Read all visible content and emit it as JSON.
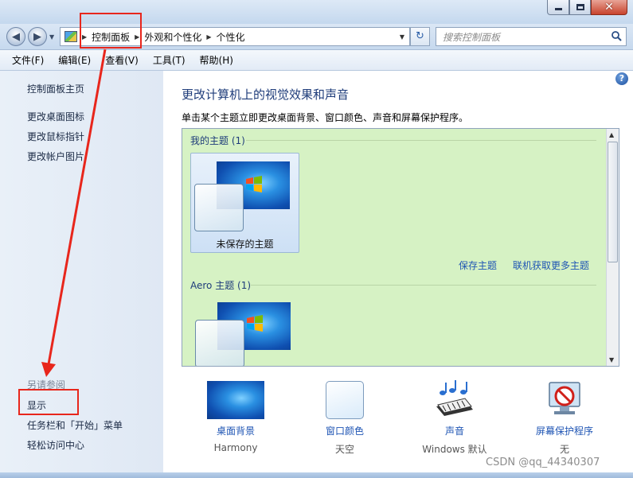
{
  "window": {
    "minimize_icon": "minimize-icon",
    "maximize_icon": "maximize-icon",
    "close_icon": "close-icon",
    "close_glyph": "✕"
  },
  "navigation": {
    "back_icon": "back-arrow-icon",
    "forward_icon": "forward-arrow-icon",
    "breadcrumbs": [
      "控制面板",
      "外观和个性化",
      "个性化"
    ],
    "search_placeholder": "搜索控制面板",
    "refresh_icon": "refresh-icon"
  },
  "menu": [
    "文件(F)",
    "编辑(E)",
    "查看(V)",
    "工具(T)",
    "帮助(H)"
  ],
  "sidebar": {
    "home_link": "控制面板主页",
    "links": [
      "更改桌面图标",
      "更改鼠标指针",
      "更改帐户图片"
    ],
    "see_also_title": "另请参阅",
    "see_also_links": [
      "显示",
      "任务栏和「开始」菜单",
      "轻松访问中心"
    ]
  },
  "main": {
    "title": "更改计算机上的视觉效果和声音",
    "description": "单击某个主题立即更改桌面背景、窗口颜色、声音和屏幕保护程序。",
    "help_icon": "help-icon",
    "my_themes_header": "我的主题 (1)",
    "unsaved_theme_name": "未保存的主题",
    "save_theme_link": "保存主题",
    "get_more_link": "联机获取更多主题",
    "aero_header": "Aero 主题 (1)"
  },
  "bottom_items": [
    {
      "label": "桌面背景",
      "value": "Harmony",
      "icon": "desktop-background-icon"
    },
    {
      "label": "窗口颜色",
      "value": "天空",
      "icon": "window-color-icon"
    },
    {
      "label": "声音",
      "value": "Windows 默认",
      "icon": "sound-icon"
    },
    {
      "label": "屏幕保护程序",
      "value": "无",
      "icon": "screensaver-icon"
    }
  ],
  "watermark": "CSDN @qq_44340307",
  "colors": {
    "annotation_red": "#e8261c",
    "theme_panel_bg": "#d6f2c4",
    "link_blue": "#1f55b4",
    "title_blue": "#1e3c7a"
  }
}
